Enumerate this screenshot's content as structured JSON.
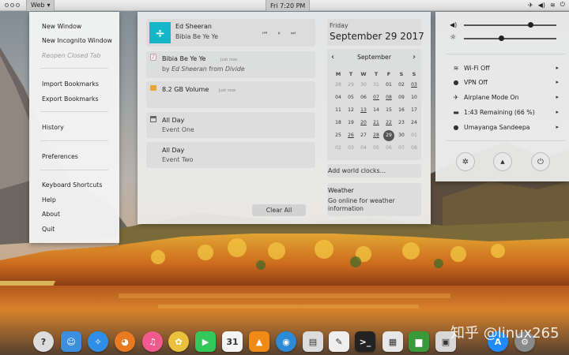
{
  "topbar": {
    "menu_label": "Web",
    "menu_arrow": "▾",
    "clock": "Fri  7:20 PM",
    "icons": [
      "airplane-icon",
      "volume-icon",
      "wifi-icon",
      "power-icon"
    ]
  },
  "menu": {
    "items": [
      {
        "label": "New Window",
        "enabled": true
      },
      {
        "label": "New Incognito Window",
        "enabled": true
      },
      {
        "label": "Reopen Closed Tab",
        "enabled": false
      },
      {
        "label": "Import Bookmarks",
        "enabled": true
      },
      {
        "label": "Export Bookmarks",
        "enabled": true
      },
      {
        "label": "History",
        "enabled": true
      },
      {
        "label": "Preferences",
        "enabled": true
      },
      {
        "label": "Keyboard Shortcuts",
        "enabled": true
      },
      {
        "label": "Help",
        "enabled": true
      },
      {
        "label": "About",
        "enabled": true
      },
      {
        "label": "Quit",
        "enabled": true
      }
    ]
  },
  "notifications": {
    "media": {
      "artist": "Ed Sheeran",
      "track": "Bibia Be Ye Ye",
      "art_glyph": "÷",
      "controls": [
        "⏮",
        "⏸",
        "⏭"
      ]
    },
    "music": {
      "title": "Bibia Be Ye Ye",
      "time": "Just now",
      "by": "by",
      "artist": "Ed Sheeran",
      "from": "from",
      "album": "Divide"
    },
    "volume": {
      "title": "8.2 GB Volume",
      "time": "Just now"
    },
    "events": [
      {
        "title": "All Day",
        "subtitle": "Event One"
      },
      {
        "title": "All Day",
        "subtitle": "Event Two"
      }
    ],
    "clear_label": "Clear All"
  },
  "calendar": {
    "weekday": "Friday",
    "date": "September 29 2017",
    "month": "September",
    "prev": "‹",
    "next": "›",
    "dow": [
      "M",
      "T",
      "W",
      "T",
      "F",
      "S",
      "S"
    ],
    "days": [
      [
        "28",
        "29",
        "30",
        "31",
        "01",
        "02"
      ],
      [
        "04",
        "05",
        "06",
        "07",
        "08",
        "09"
      ]
    ],
    "world_clocks": "Add world clocks...",
    "weather_title": "Weather",
    "weather_text": "Go online for weather information"
  },
  "control": {
    "volume_level": 0.72,
    "brightness_level": 0.4,
    "rows": [
      {
        "icon": "wifi-icon",
        "glyph": "≋",
        "label": "Wi-Fi Off"
      },
      {
        "icon": "vpn-icon",
        "glyph": "●",
        "label": "VPN Off"
      },
      {
        "icon": "airplane-icon",
        "glyph": "✈",
        "label": "Airplane Mode On"
      },
      {
        "icon": "battery-icon",
        "glyph": "▬",
        "label": "1:43 Remaining (66 %)"
      },
      {
        "icon": "user-icon",
        "glyph": "●",
        "label": "Umayanga Sandeepa"
      }
    ],
    "arrow": "▸",
    "buttons": [
      {
        "icon": "settings-icon",
        "glyph": "✲"
      },
      {
        "icon": "lock-icon",
        "glyph": "▲"
      },
      {
        "icon": "power-icon",
        "glyph": "⏻"
      }
    ]
  },
  "watermark": "知乎 @linux265",
  "dock": [
    {
      "name": "help-icon",
      "glyph": "?",
      "color": "#ddd"
    },
    {
      "name": "finder-icon",
      "glyph": "☺",
      "color": "#3c8fe0"
    },
    {
      "name": "safari-icon",
      "glyph": "✧",
      "color": "#2f8fe8"
    },
    {
      "name": "firefox-icon",
      "glyph": "◕",
      "color": "#e87a22"
    },
    {
      "name": "itunes-icon",
      "glyph": "♫",
      "color": "#f05a8e"
    },
    {
      "name": "photos-icon",
      "glyph": "✿",
      "color": "#e9c13c"
    },
    {
      "name": "facetime-icon",
      "glyph": "▶",
      "color": "#34c759"
    },
    {
      "name": "calendar-icon",
      "glyph": "31",
      "color": "#f4f4f4"
    },
    {
      "name": "vlc-icon",
      "glyph": "▲",
      "color": "#f08a16"
    },
    {
      "name": "screenshot-icon",
      "glyph": "◉",
      "color": "#2d8ad6"
    },
    {
      "name": "contacts-icon",
      "glyph": "▤",
      "color": "#dcdcdc"
    },
    {
      "name": "textedit-icon",
      "glyph": "✎",
      "color": "#efefef"
    },
    {
      "name": "terminal-icon",
      "glyph": ">_",
      "color": "#222"
    },
    {
      "name": "preview-icon",
      "glyph": "▦",
      "color": "#e7e7e7"
    },
    {
      "name": "stats-icon",
      "glyph": "▆",
      "color": "#3a9a3a"
    },
    {
      "name": "photo-booth-icon",
      "glyph": "▣",
      "color": "#d8d8d8"
    },
    {
      "name": "app-store-icon",
      "glyph": "A",
      "color": "#1f8bff"
    },
    {
      "name": "system-preferences-icon",
      "glyph": "⚙",
      "color": "#8a8a8a"
    }
  ]
}
